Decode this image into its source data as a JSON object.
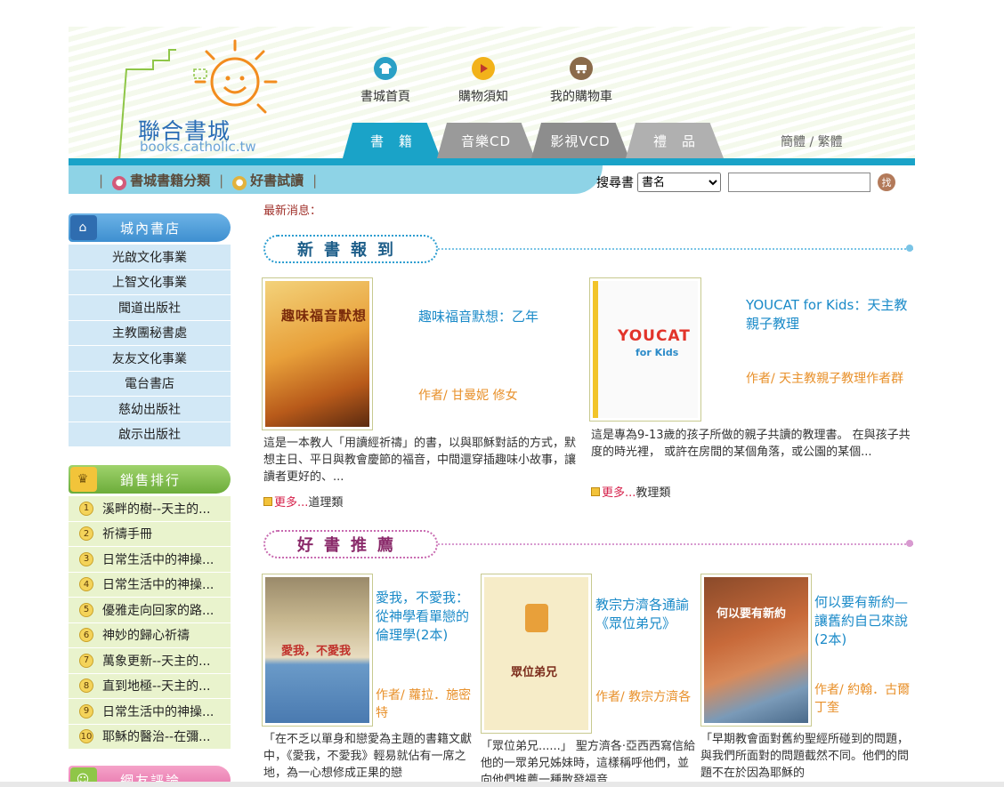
{
  "header": {
    "logo_text": "聯合書城",
    "logo_url": "books.catholic.tw",
    "topnav": [
      {
        "label": "書城首頁",
        "icon": "shirt-icon",
        "color": "#2aa0c6"
      },
      {
        "label": "購物須知",
        "icon": "play-icon",
        "color": "#f2b21a"
      },
      {
        "label": "我的購物車",
        "icon": "cart-icon",
        "color": "#7a5a3a"
      }
    ],
    "tabs": [
      "書　籍",
      "音樂CD",
      "影視VCD",
      "禮　品"
    ],
    "lang": "簡體 / 繁體",
    "subnav": [
      "書城書籍分類",
      "好書試讀"
    ],
    "search": {
      "label": "搜尋書",
      "selected": "書名",
      "value": ""
    }
  },
  "sidebar": {
    "stores_title": "城內書店",
    "stores": [
      "光啟文化事業",
      "上智文化事業",
      "聞道出版社",
      "主教團秘書處",
      "友友文化事業",
      "電台書店",
      "慈幼出版社",
      "啟示出版社"
    ],
    "sales_title": "銷售排行",
    "sales": [
      {
        "rank": "1",
        "title": "溪畔的樹--天主的..."
      },
      {
        "rank": "2",
        "title": "祈禱手冊"
      },
      {
        "rank": "3",
        "title": "日常生活中的神操..."
      },
      {
        "rank": "4",
        "title": "日常生活中的神操..."
      },
      {
        "rank": "5",
        "title": "優雅走向回家的路..."
      },
      {
        "rank": "6",
        "title": "神妙的歸心祈禱"
      },
      {
        "rank": "7",
        "title": "萬象更新--天主的..."
      },
      {
        "rank": "8",
        "title": "直到地極--天主的..."
      },
      {
        "rank": "9",
        "title": "日常生活中的神操..."
      },
      {
        "rank": "10",
        "title": "耶穌的醫治--在彌..."
      }
    ],
    "review_title": "網友評論"
  },
  "main": {
    "news_label": "最新消息：",
    "new_books_title": "新書報到",
    "new_books": [
      {
        "title": "趣味福音默想：乙年",
        "author": "作者/ 甘曼妮 修女",
        "desc": "這是一本教人「用讀經祈禱」的書，以與耶穌對話的方式，默想主日、平日與教會慶節的福音，中間還穿插趣味小故事，讓讀者更好的、...",
        "more": "更多...",
        "category": "道理類",
        "cover_text": "趣味福音默想"
      },
      {
        "title": "YOUCAT for Kids：天主教親子教理",
        "author": "作者/ 天主教親子教理作者群",
        "desc": "這是專為9-13歲的孩子所做的親子共讀的教理書。 在與孩子共度的時光裡， 或許在房間的某個角落，或公園的某個...",
        "more": "更多...",
        "category": "教理類",
        "cover_text": "YOUCAT",
        "cover_sub": "for Kids"
      }
    ],
    "recommend_title": "好書推薦",
    "recommend": [
      {
        "title": "愛我，不愛我：從神學看單戀的倫理學(2本)",
        "author": "作者/ 蘿拉．施密特",
        "desc": "「在不乏以單身和戀愛為主題的書籍文獻中，《愛我，不愛我》輕易就佔有一席之地，為一心想修成正果的戀",
        "cover_text": "愛我，不愛我"
      },
      {
        "title": "教宗方濟各通諭《眾位弟兄》",
        "author": "作者/ 教宗方濟各",
        "desc": "「眾位弟兄......」 聖方濟各‧亞西西寫信給他的一眾弟兄姊妹時，這樣稱呼他們，並向他們推薦一種散發福音",
        "cover_text": "眾位弟兄"
      },
      {
        "title": "何以要有新約—讓舊約自己來說 (2本)",
        "author": "作者/ 約翰．古爾丁奎",
        "desc": "「早期教會面對舊約聖經所碰到的問題，與我們所面對的問題截然不同。他們的問題不在於因為耶穌的",
        "cover_text": "何以要有新約"
      }
    ]
  },
  "colors": {
    "accent": "#1aa3c8",
    "link": "#1a8ac8",
    "author": "#e8902a",
    "new_section": "#2b9dd0",
    "rec_section": "#c86ab0"
  }
}
